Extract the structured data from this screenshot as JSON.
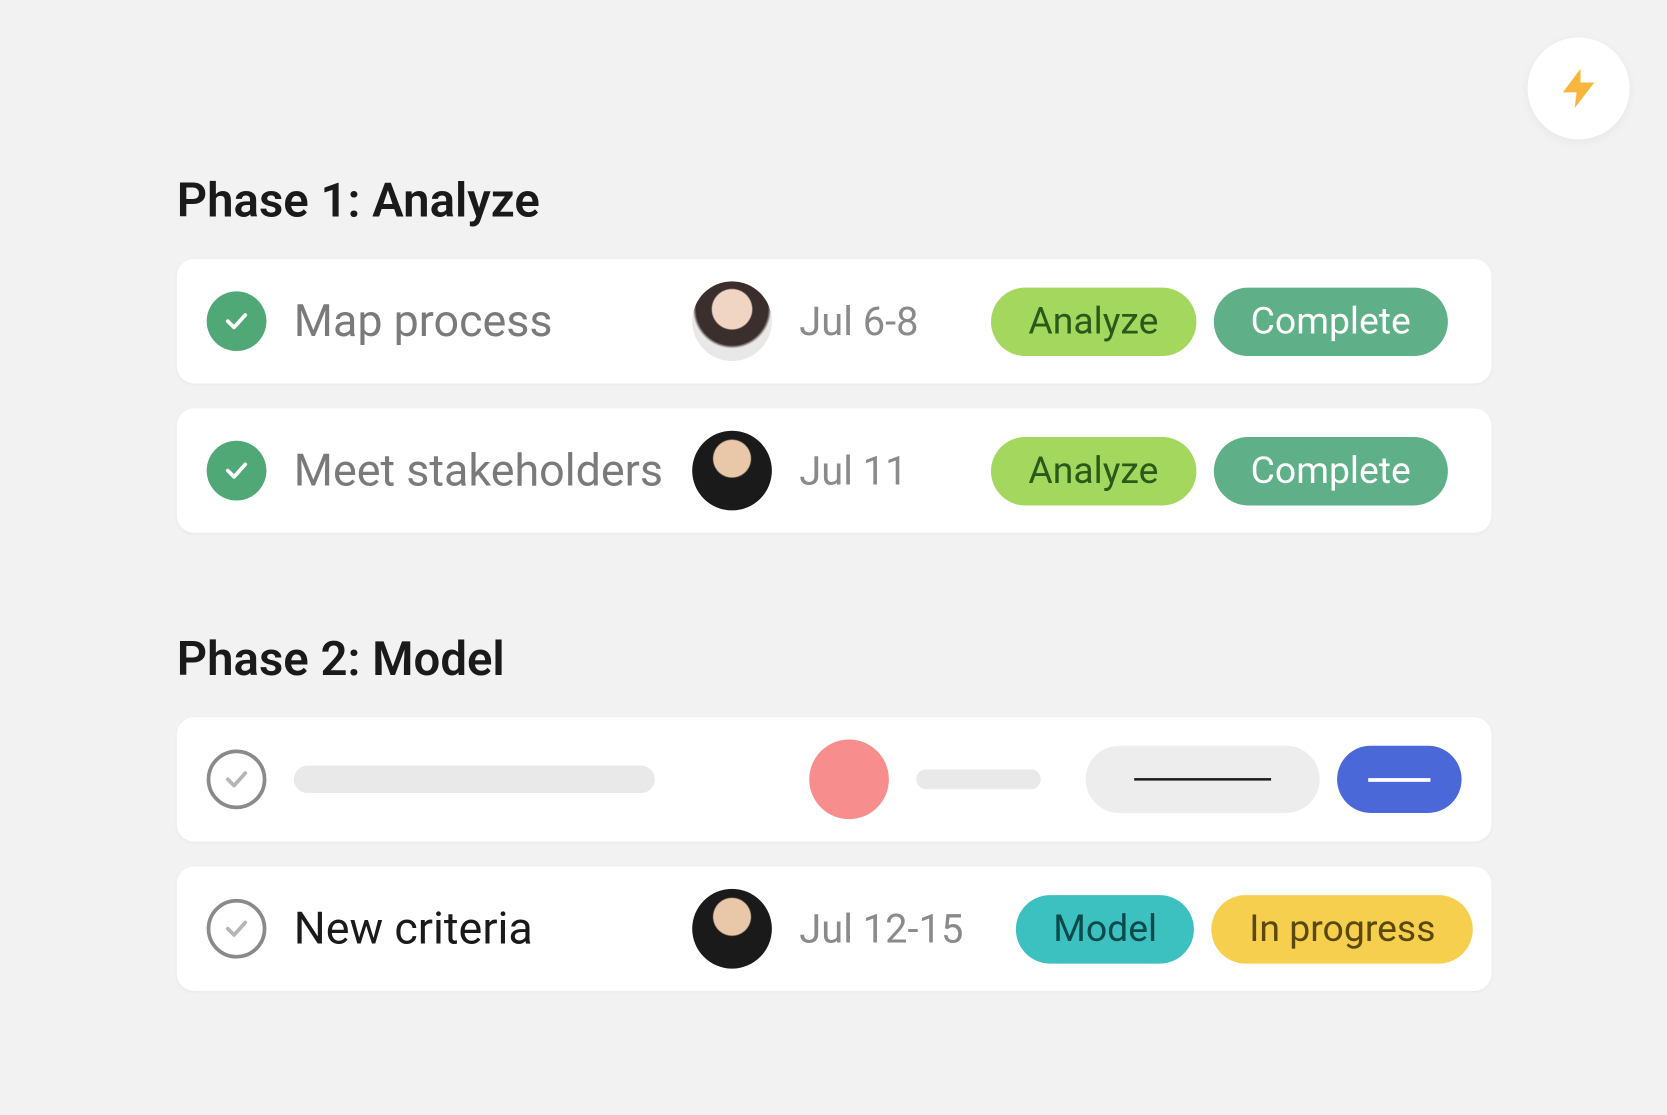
{
  "phases": [
    {
      "title": "Phase 1: Analyze",
      "tasks": [
        {
          "name": "Map process",
          "done": true,
          "date": "Jul 6-8",
          "phase_label": "Analyze",
          "status_label": "Complete",
          "assignee": "a1"
        },
        {
          "name": "Meet stakeholders",
          "done": true,
          "date": "Jul 11",
          "phase_label": "Analyze",
          "status_label": "Complete",
          "assignee": "a2"
        }
      ]
    },
    {
      "title": "Phase 2: Model",
      "tasks": [
        {
          "placeholder": true,
          "done": false
        },
        {
          "name": "New criteria",
          "done": false,
          "date": "Jul 12-15",
          "phase_label": "Model",
          "status_label": "In progress",
          "assignee": "a2"
        }
      ]
    }
  ],
  "colors": {
    "analyze_pill": "#a3d75e",
    "complete_pill": "#5fb088",
    "model_pill": "#3dc0c0",
    "progress_pill": "#f6cf4f",
    "bolt": "#f6b73c"
  }
}
